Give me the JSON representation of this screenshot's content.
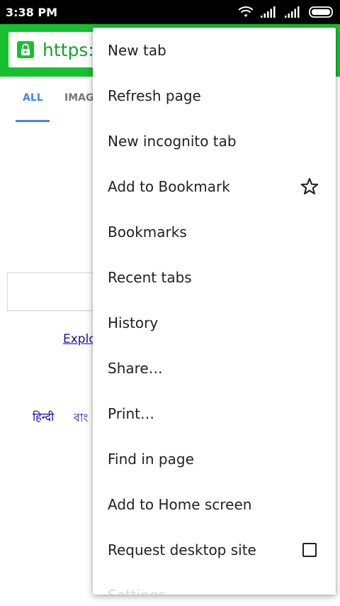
{
  "status_bar": {
    "time": "3:38 PM",
    "icons": [
      "wifi-icon",
      "signal-icon",
      "signal-icon",
      "battery-icon"
    ]
  },
  "toolbar": {
    "url": "https://",
    "lock_icon": "lock-icon",
    "accent_color": "#17c12d"
  },
  "page": {
    "tabs": [
      {
        "label": "ALL",
        "selected": true
      },
      {
        "label": "IMAG",
        "selected": false
      }
    ],
    "explore_link": "Explo",
    "languages": [
      "हिन्दी",
      "বাং"
    ]
  },
  "menu": {
    "items": [
      {
        "label": "New tab"
      },
      {
        "label": "Refresh page"
      },
      {
        "label": "New incognito tab"
      },
      {
        "label": "Add to Bookmark",
        "trailing_icon": "star-outline-icon"
      },
      {
        "label": "Bookmarks"
      },
      {
        "label": "Recent tabs"
      },
      {
        "label": "History"
      },
      {
        "label": "Share…"
      },
      {
        "label": "Print…"
      },
      {
        "label": "Find in page"
      },
      {
        "label": "Add to Home screen"
      },
      {
        "label": "Request desktop site",
        "checked": false
      },
      {
        "label": "Settings"
      }
    ]
  }
}
